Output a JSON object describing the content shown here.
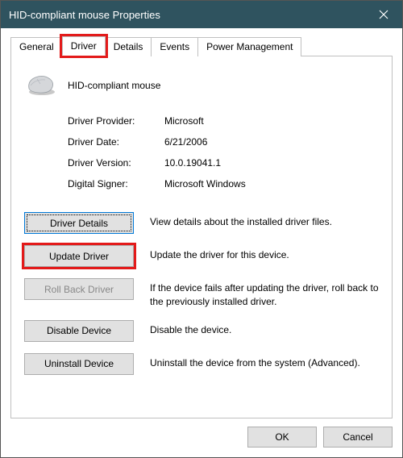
{
  "titlebar": {
    "title": "HID-compliant mouse Properties"
  },
  "tabs": [
    {
      "label": "General",
      "active": false
    },
    {
      "label": "Driver",
      "active": true,
      "highlighted": true
    },
    {
      "label": "Details",
      "active": false
    },
    {
      "label": "Events",
      "active": false
    },
    {
      "label": "Power Management",
      "active": false
    }
  ],
  "device": {
    "name": "HID-compliant mouse"
  },
  "info": [
    {
      "label": "Driver Provider:",
      "value": "Microsoft"
    },
    {
      "label": "Driver Date:",
      "value": "6/21/2006"
    },
    {
      "label": "Driver Version:",
      "value": "10.0.19041.1"
    },
    {
      "label": "Digital Signer:",
      "value": "Microsoft Windows"
    }
  ],
  "actions": [
    {
      "label": "Driver Details",
      "desc": "View details about the installed driver files.",
      "focused": true
    },
    {
      "label": "Update Driver",
      "desc": "Update the driver for this device.",
      "highlighted": true
    },
    {
      "label": "Roll Back Driver",
      "desc": "If the device fails after updating the driver, roll back to the previously installed driver.",
      "disabled": true
    },
    {
      "label": "Disable Device",
      "desc": "Disable the device."
    },
    {
      "label": "Uninstall Device",
      "desc": "Uninstall the device from the system (Advanced)."
    }
  ],
  "footer": {
    "ok": "OK",
    "cancel": "Cancel"
  }
}
